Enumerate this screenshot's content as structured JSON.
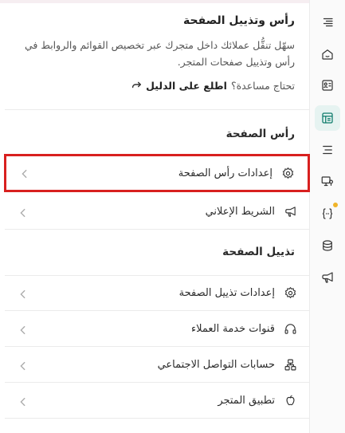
{
  "intro": {
    "title": "رأس وتذييل الصفحة",
    "description": "سهّل تنقُّل عملائك داخل متجرك عبر تخصيص القوائم والروابط في رأس وتذييل صفحات المتجر.",
    "help_prefix": "تحتاج مساعدة؟",
    "help_link": "اطلع على الدليل",
    "help_icon": "reply-arrow-icon"
  },
  "header_section": {
    "title": "رأس الصفحة",
    "items": [
      {
        "label": "إعدادات رأس الصفحة",
        "icon": "gear-icon"
      },
      {
        "label": "الشريط الإعلاني",
        "icon": "megaphone-icon"
      }
    ]
  },
  "footer_section": {
    "title": "تذييل الصفحة",
    "items": [
      {
        "label": "إعدادات تذييل الصفحة",
        "icon": "gear-icon"
      },
      {
        "label": "قنوات خدمة العملاء",
        "icon": "headset-icon"
      },
      {
        "label": "حسابات التواصل الاجتماعي",
        "icon": "network-icon"
      },
      {
        "label": "تطبيق المتجر",
        "icon": "apple-icon"
      }
    ]
  },
  "rail": {
    "items": [
      {
        "icon": "align-right-icon"
      },
      {
        "icon": "home-icon"
      },
      {
        "icon": "id-card-icon"
      },
      {
        "icon": "layout-icon",
        "active": true
      },
      {
        "icon": "menu-lines-icon"
      },
      {
        "icon": "monitor-pin-icon"
      },
      {
        "icon": "code-braces-icon",
        "badge": true
      },
      {
        "icon": "database-icon"
      },
      {
        "icon": "megaphone-icon"
      }
    ],
    "accent": "#0e7c6b",
    "badge_color": "#f0b429"
  },
  "colors": {
    "highlight": "#d8201f",
    "active_bg": "#e6f3f1"
  }
}
